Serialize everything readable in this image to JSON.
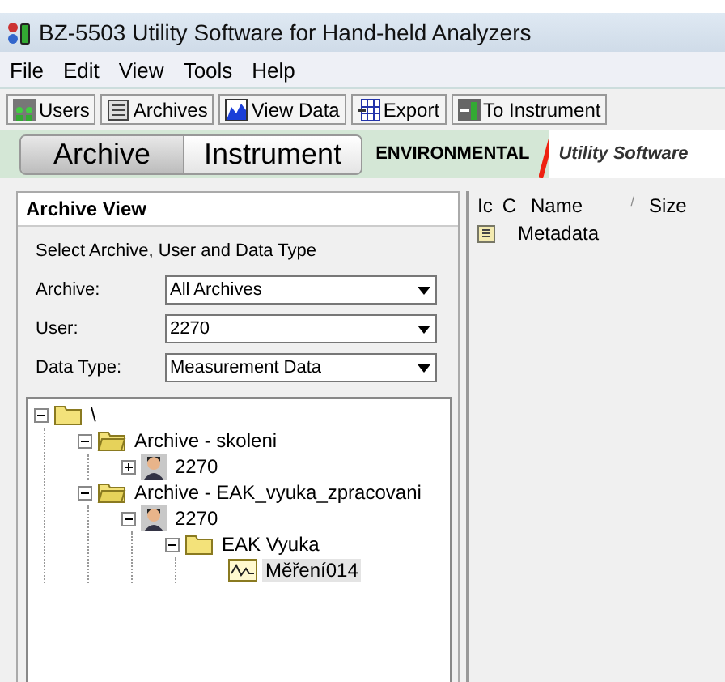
{
  "window": {
    "title": "BZ-5503 Utility Software for Hand-held Analyzers"
  },
  "menu": [
    "File",
    "Edit",
    "View",
    "Tools",
    "Help"
  ],
  "toolbar": [
    {
      "label": "Users",
      "kind": "users"
    },
    {
      "label": "Archives",
      "kind": "archives"
    },
    {
      "label": "View Data",
      "kind": "chart"
    },
    {
      "label": "Export",
      "kind": "export"
    },
    {
      "label": "To Instrument",
      "kind": "instrument"
    }
  ],
  "tabs": [
    {
      "label": "Archive",
      "selected": true
    },
    {
      "label": "Instrument",
      "selected": false
    }
  ],
  "brand": {
    "category": "ENVIRONMENTAL",
    "product": "Utility Software"
  },
  "panel": {
    "title": "Archive View",
    "instruction": "Select Archive, User and Data Type",
    "fields": [
      {
        "label": "Archive:",
        "value": "All Archives"
      },
      {
        "label": "User:",
        "value": "2270"
      },
      {
        "label": "Data Type:",
        "value": "Measurement Data"
      }
    ],
    "tree": [
      {
        "label": "\\",
        "kind": "folder",
        "expanded": true,
        "selected": false,
        "children": [
          {
            "label": "Archive - skoleni",
            "kind": "archive",
            "expanded": true,
            "selected": false,
            "children": [
              {
                "label": "2270",
                "kind": "user",
                "expanded": false,
                "selected": false
              }
            ]
          },
          {
            "label": "Archive - EAK_vyuka_zpracovani",
            "kind": "archive",
            "expanded": true,
            "selected": false,
            "children": [
              {
                "label": "2270",
                "kind": "user",
                "expanded": true,
                "selected": false,
                "children": [
                  {
                    "label": "EAK Vyuka",
                    "kind": "folder",
                    "expanded": true,
                    "selected": false,
                    "children": [
                      {
                        "label": "Měření014",
                        "kind": "measurement",
                        "selected": true
                      }
                    ]
                  }
                ]
              }
            ]
          }
        ]
      }
    ]
  },
  "list": {
    "columns": [
      "Ic",
      "C",
      "Name",
      "Size"
    ],
    "sort_mark": "/",
    "rows": [
      {
        "name": "Metadata"
      }
    ]
  }
}
